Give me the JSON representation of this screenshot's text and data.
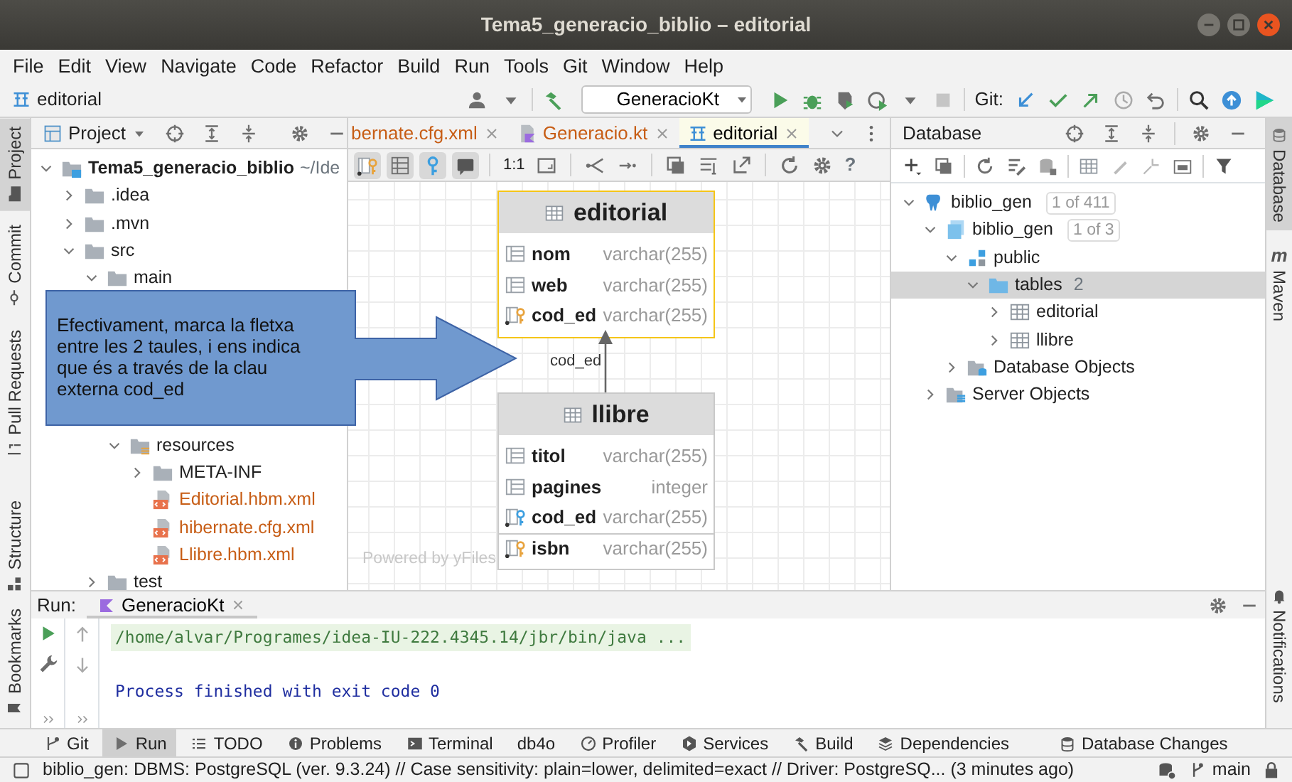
{
  "window": {
    "title": "Tema5_generacio_biblio – editorial"
  },
  "menu": [
    "File",
    "Edit",
    "View",
    "Navigate",
    "Code",
    "Refactor",
    "Build",
    "Run",
    "Tools",
    "Git",
    "Window",
    "Help"
  ],
  "navbar": {
    "breadcrumb": "editorial",
    "run_config": "GeneracioKt",
    "git_label": "Git:"
  },
  "left_stripe": [
    {
      "label": "Project",
      "selected": true
    },
    {
      "label": "Commit",
      "selected": false
    },
    {
      "label": "Pull Requests",
      "selected": false
    },
    {
      "label": "Structure",
      "selected": false
    },
    {
      "label": "Bookmarks",
      "selected": false
    }
  ],
  "project_panel": {
    "title": "Project",
    "tree": [
      {
        "label": "Tema5_generacio_biblio",
        "hint": "~/Ide",
        "kind": "module",
        "expanded": true,
        "children": [
          {
            "label": ".idea",
            "kind": "folder",
            "expanded": false
          },
          {
            "label": ".mvn",
            "kind": "folder",
            "expanded": false
          },
          {
            "label": "src",
            "kind": "folder",
            "expanded": true,
            "children": [
              {
                "label": "main",
                "kind": "folder",
                "expanded": true,
                "children": [
                  {
                    "label": "resources",
                    "kind": "resources",
                    "expanded": true,
                    "children": [
                      {
                        "label": "META-INF",
                        "kind": "folder",
                        "expanded": false
                      },
                      {
                        "label": "Editorial.hbm.xml",
                        "kind": "xml"
                      },
                      {
                        "label": "hibernate.cfg.xml",
                        "kind": "xml"
                      },
                      {
                        "label": "Llibre.hbm.xml",
                        "kind": "xml"
                      }
                    ]
                  }
                ]
              },
              {
                "label": "test",
                "kind": "folder",
                "expanded": false
              }
            ]
          }
        ]
      }
    ]
  },
  "editor_tabs": [
    {
      "label": "bernate.cfg.xml",
      "kind": "xml",
      "selected": false
    },
    {
      "label": "Generacio.kt",
      "kind": "kotlin",
      "selected": false
    },
    {
      "label": "editorial",
      "kind": "diagram",
      "selected": true
    }
  ],
  "diagram_toolbar": {
    "toggles": [
      {
        "on": true
      },
      {
        "on": true
      },
      {
        "on": true
      },
      {
        "on": true
      }
    ],
    "zoom_label": "1:1",
    "help": "?"
  },
  "diagram": {
    "tables": [
      {
        "name": "editorial",
        "selected": true,
        "columns": [
          {
            "name": "nom",
            "type": "varchar(255)",
            "kind": "column",
            "separated": false
          },
          {
            "name": "web",
            "type": "varchar(255)",
            "kind": "column",
            "separated": false
          },
          {
            "name": "cod_ed",
            "type": "varchar(255)",
            "kind": "primary_key",
            "separated": false
          }
        ]
      },
      {
        "name": "llibre",
        "selected": false,
        "columns": [
          {
            "name": "titol",
            "type": "varchar(255)",
            "kind": "column",
            "separated": false
          },
          {
            "name": "pagines",
            "type": "integer",
            "kind": "column",
            "separated": false
          },
          {
            "name": "cod_ed",
            "type": "varchar(255)",
            "kind": "foreign_key",
            "separated": false
          },
          {
            "name": "isbn",
            "type": "varchar(255)",
            "kind": "primary_key",
            "separated": true
          }
        ]
      }
    ],
    "relation": {
      "label": "cod_ed"
    },
    "footer_note": "Powered by yFiles"
  },
  "callout": {
    "text": "Efectivament, marca la fletxa entre les 2 taules, i ens indica que és a través de la clau externa cod_ed"
  },
  "database_panel": {
    "title": "Database",
    "tree": [
      {
        "label": "biblio_gen",
        "badge": "1 of 411",
        "kind": "datasource",
        "expanded": true,
        "selected": false,
        "children": [
          {
            "label": "biblio_gen",
            "badge": "1 of 3",
            "kind": "database",
            "expanded": true,
            "selected": false,
            "children": [
              {
                "label": "public",
                "kind": "schema",
                "expanded": true,
                "selected": false,
                "children": [
                  {
                    "label": "tables",
                    "count": "2",
                    "kind": "folder",
                    "expanded": true,
                    "selected": true,
                    "children": [
                      {
                        "label": "editorial",
                        "kind": "table",
                        "expanded": false,
                        "selected": false
                      },
                      {
                        "label": "llibre",
                        "kind": "table",
                        "expanded": false,
                        "selected": false
                      }
                    ]
                  }
                ]
              },
              {
                "label": "Database Objects",
                "kind": "objects",
                "expanded": false,
                "selected": false
              }
            ]
          },
          {
            "label": "Server Objects",
            "kind": "server",
            "expanded": false,
            "selected": false
          }
        ]
      }
    ]
  },
  "right_stripe": [
    {
      "label": "Database",
      "selected": true
    },
    {
      "label": "Maven",
      "selected": false,
      "glyph": "m"
    },
    {
      "label": "Notifications",
      "selected": false
    }
  ],
  "run_panel": {
    "label": "Run:",
    "tabs": [
      {
        "label": "GeneracioKt",
        "selected": true
      }
    ],
    "output": [
      {
        "kind": "command",
        "text": "/home/alvar/Programes/idea-IU-222.4345.14/jbr/bin/java ..."
      },
      {
        "kind": "exit",
        "text": "Process finished with exit code 0"
      }
    ]
  },
  "tool_windows": [
    {
      "label": "Git",
      "selected": false
    },
    {
      "label": "Run",
      "selected": true
    },
    {
      "label": "TODO",
      "selected": false
    },
    {
      "label": "Problems",
      "selected": false
    },
    {
      "label": "Terminal",
      "selected": false
    },
    {
      "label": "db4o",
      "selected": false
    },
    {
      "label": "Profiler",
      "selected": false
    },
    {
      "label": "Services",
      "selected": false
    },
    {
      "label": "Build",
      "selected": false
    },
    {
      "label": "Dependencies",
      "selected": false
    },
    {
      "label": "Database Changes",
      "selected": false
    }
  ],
  "status_bar": {
    "text": "biblio_gen: DBMS: PostgreSQL (ver. 9.3.24) // Case sensitivity: plain=lower, delimited=exact // Driver: PostgreSQ... (3 minutes ago)",
    "branch": "main"
  }
}
